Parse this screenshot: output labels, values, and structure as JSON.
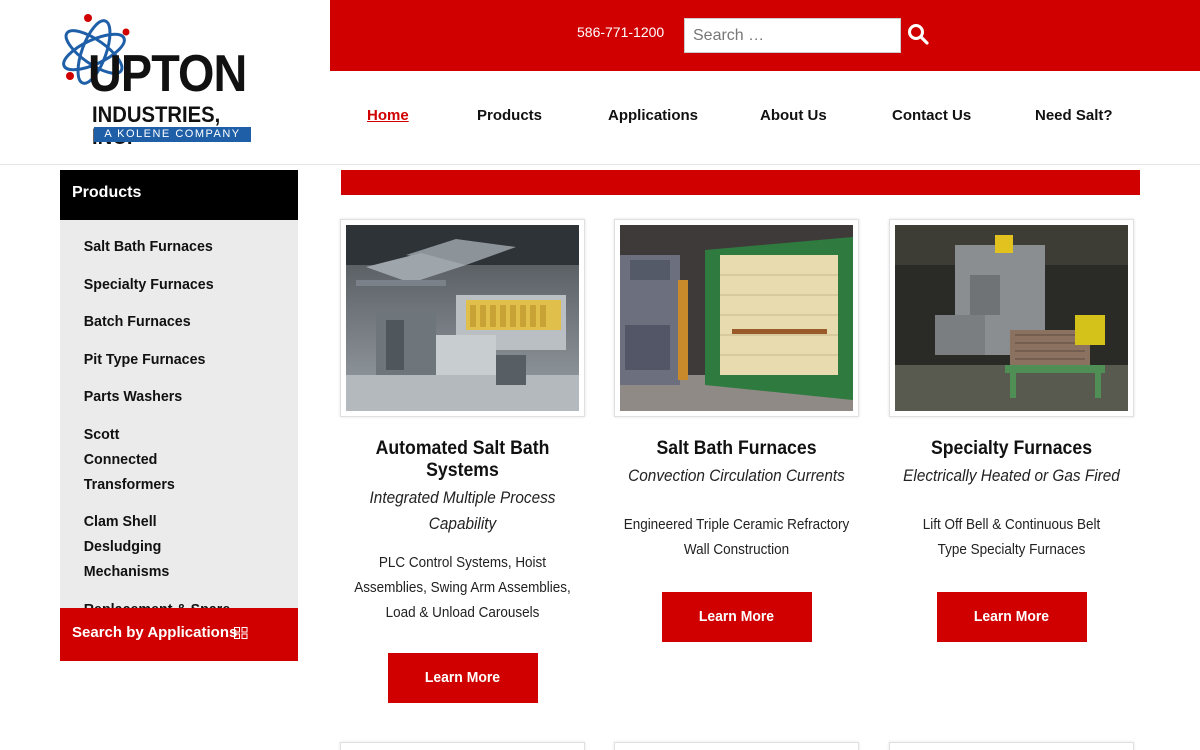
{
  "brand": {
    "name": "UPTON",
    "subname": "INDUSTRIES, INC.",
    "tagline": "A KOLENE COMPANY",
    "colors": {
      "red": "#d00000",
      "blue": "#1e5fa8",
      "black": "#111111"
    }
  },
  "header": {
    "phone": "586-771-1200",
    "search_placeholder": "Search …",
    "search_icon": "search-icon"
  },
  "nav": [
    {
      "label": "Home",
      "active": true
    },
    {
      "label": "Products"
    },
    {
      "label": "Applications"
    },
    {
      "label": "About Us"
    },
    {
      "label": "Contact Us"
    },
    {
      "label": "Need Salt?"
    }
  ],
  "sidebar": {
    "title": "Products",
    "items": [
      {
        "label": "Salt Bath Furnaces"
      },
      {
        "label": "Specialty Furnaces"
      },
      {
        "label": "Batch Furnaces"
      },
      {
        "label": "Pit Type Furnaces"
      },
      {
        "label": "Parts Washers"
      },
      {
        "label": "Scott Connected Transformers"
      },
      {
        "label": "Clam Shell Desludging Mechanisms"
      },
      {
        "label": "Replacement & Spare Parts"
      }
    ],
    "footer": {
      "label": "Search by Applications",
      "icon": "grid-icon"
    }
  },
  "cards": [
    {
      "title": "Automated Salt Bath Systems",
      "subtitle": "Integrated Multiple Process Capability",
      "description": "PLC Control Systems, Hoist Assemblies, Swing Arm Assemblies, Load & Unload Carousels",
      "button": "Learn More"
    },
    {
      "title": "Salt Bath Furnaces",
      "subtitle": "Convection Circulation Currents",
      "description": "Engineered Triple Ceramic Refractory Wall Construction",
      "button": "Learn More"
    },
    {
      "title": "Specialty Furnaces",
      "subtitle": "Electrically Heated or Gas Fired",
      "description": "Lift Off Bell & Continuous Belt Type Specialty Furnaces",
      "button": "Learn More"
    }
  ]
}
